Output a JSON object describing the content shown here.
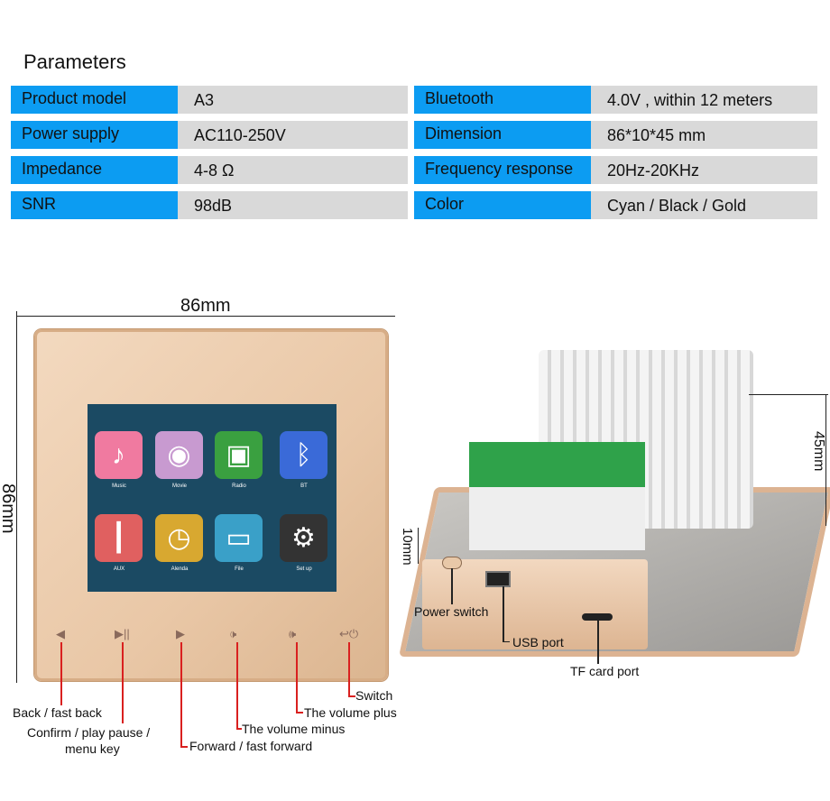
{
  "title": "Parameters",
  "params_left": [
    {
      "label": "Product model",
      "value": "A3"
    },
    {
      "label": "Power supply",
      "value": "AC110-250V"
    },
    {
      "label": "Impedance",
      "value": "4-8 Ω"
    },
    {
      "label": "SNR",
      "value": "98dB"
    }
  ],
  "params_right": [
    {
      "label": "Bluetooth",
      "value": "4.0V , within 12 meters"
    },
    {
      "label": "Dimension",
      "value": "86*10*45 mm"
    },
    {
      "label": "Frequency response",
      "value": "20Hz-20KHz"
    },
    {
      "label": "Color",
      "value": "Cyan / Black / Gold"
    }
  ],
  "dimensions": {
    "width": "86mm",
    "height": "86mm",
    "depth": "45mm",
    "thickness": "10mm"
  },
  "apps": [
    {
      "label": "Music",
      "icon": "music-note-icon",
      "glyph": "♪",
      "color": "#f07aa0"
    },
    {
      "label": "Movie",
      "icon": "film-reel-icon",
      "glyph": "◉",
      "color": "#c89ad0"
    },
    {
      "label": "Radio",
      "icon": "radio-icon",
      "glyph": "▣",
      "color": "#3aa040"
    },
    {
      "label": "BT",
      "icon": "bluetooth-icon",
      "glyph": "ᛒ",
      "color": "#3a6ad8"
    },
    {
      "label": "AUX",
      "icon": "aux-jack-icon",
      "glyph": "┃",
      "color": "#e06060"
    },
    {
      "label": "Alenda",
      "icon": "clock-icon",
      "glyph": "◷",
      "color": "#d8a830"
    },
    {
      "label": "File",
      "icon": "folder-icon",
      "glyph": "▭",
      "color": "#3aa0c8"
    },
    {
      "label": "Set up",
      "icon": "gear-icon",
      "glyph": "⚙",
      "color": "#333333"
    }
  ],
  "buttons": [
    {
      "icon": "back-icon",
      "glyph": "◀"
    },
    {
      "icon": "play-pause-icon",
      "glyph": "▶||"
    },
    {
      "icon": "forward-icon",
      "glyph": "▶"
    },
    {
      "icon": "volume-minus-icon",
      "glyph": "🕩"
    },
    {
      "icon": "volume-plus-icon",
      "glyph": "🕪"
    },
    {
      "icon": "power-switch-icon",
      "glyph": "↩⏻"
    }
  ],
  "callouts": {
    "back": "Back / fast back",
    "confirm1": "Confirm / play pause /",
    "confirm2": "menu key",
    "forward": "Forward / fast forward",
    "vol_minus": "The volume minus",
    "vol_plus": "The volume plus",
    "switch": "Switch",
    "power_switch": "Power switch",
    "usb": "USB port",
    "tf": "TF card port"
  }
}
